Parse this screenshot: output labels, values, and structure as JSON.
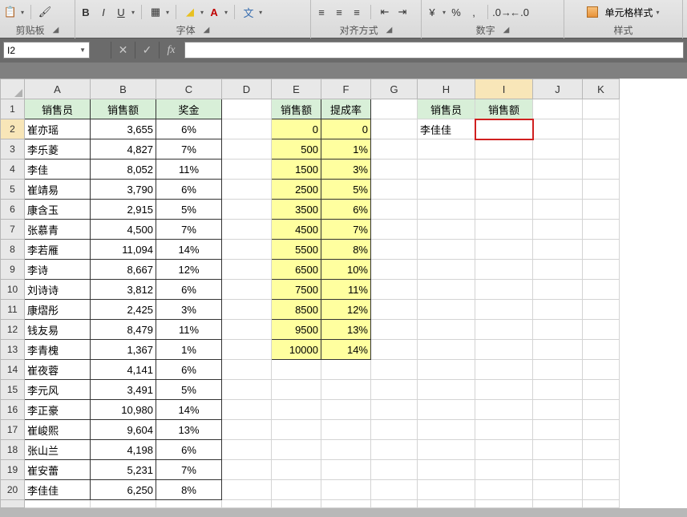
{
  "ribbon": {
    "clipboard": {
      "label": "剪贴板"
    },
    "font": {
      "label": "字体"
    },
    "align": {
      "label": "对齐方式"
    },
    "number": {
      "label": "数字"
    },
    "styles": {
      "label": "样式",
      "cellStylesBtn": "单元格样式"
    }
  },
  "namebox": {
    "value": "I2"
  },
  "formula": {
    "value": ""
  },
  "columns": [
    "A",
    "B",
    "C",
    "D",
    "E",
    "F",
    "G",
    "H",
    "I",
    "J",
    "K"
  ],
  "activeCol": "I",
  "activeRow": 2,
  "headers": {
    "A1": "销售员",
    "B1": "销售额",
    "C1": "奖金",
    "E1": "销售额",
    "F1": "提成率",
    "H1": "销售员",
    "I1": "销售额"
  },
  "tableABC": [
    {
      "name": "崔亦瑶",
      "amount": "3,655",
      "bonus": "6%"
    },
    {
      "name": "李乐菱",
      "amount": "4,827",
      "bonus": "7%"
    },
    {
      "name": "李佳",
      "amount": "8,052",
      "bonus": "11%"
    },
    {
      "name": "崔靖易",
      "amount": "3,790",
      "bonus": "6%"
    },
    {
      "name": "康含玉",
      "amount": "2,915",
      "bonus": "5%"
    },
    {
      "name": "张慕青",
      "amount": "4,500",
      "bonus": "7%"
    },
    {
      "name": "李若雁",
      "amount": "11,094",
      "bonus": "14%"
    },
    {
      "name": "李诗",
      "amount": "8,667",
      "bonus": "12%"
    },
    {
      "name": "刘诗诗",
      "amount": "3,812",
      "bonus": "6%"
    },
    {
      "name": "康熠彤",
      "amount": "2,425",
      "bonus": "3%"
    },
    {
      "name": "钱友易",
      "amount": "8,479",
      "bonus": "11%"
    },
    {
      "name": "李青槐",
      "amount": "1,367",
      "bonus": "1%"
    },
    {
      "name": "崔夜蓉",
      "amount": "4,141",
      "bonus": "6%"
    },
    {
      "name": "李元风",
      "amount": "3,491",
      "bonus": "5%"
    },
    {
      "name": "李正豪",
      "amount": "10,980",
      "bonus": "14%"
    },
    {
      "name": "崔峻熙",
      "amount": "9,604",
      "bonus": "13%"
    },
    {
      "name": "张山兰",
      "amount": "4,198",
      "bonus": "6%"
    },
    {
      "name": "崔安蕾",
      "amount": "5,231",
      "bonus": "7%"
    },
    {
      "name": "李佳佳",
      "amount": "6,250",
      "bonus": "8%"
    }
  ],
  "tableEF": [
    {
      "e": "0",
      "f": "0"
    },
    {
      "e": "500",
      "f": "1%"
    },
    {
      "e": "1500",
      "f": "3%"
    },
    {
      "e": "2500",
      "f": "5%"
    },
    {
      "e": "3500",
      "f": "6%"
    },
    {
      "e": "4500",
      "f": "7%"
    },
    {
      "e": "5500",
      "f": "8%"
    },
    {
      "e": "6500",
      "f": "10%"
    },
    {
      "e": "7500",
      "f": "11%"
    },
    {
      "e": "8500",
      "f": "12%"
    },
    {
      "e": "9500",
      "f": "13%"
    },
    {
      "e": "10000",
      "f": "14%"
    }
  ],
  "lookup": {
    "H2": "李佳佳"
  },
  "rowCount": 20
}
